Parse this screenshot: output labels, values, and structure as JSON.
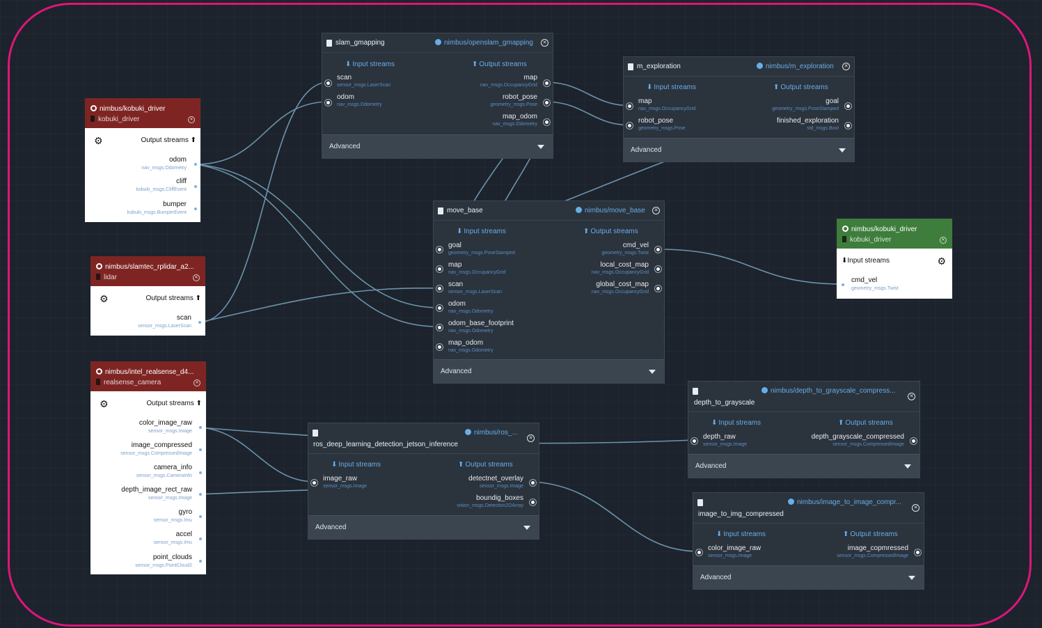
{
  "colors": {
    "canvas": "#1c232c",
    "frame": "#e0157a",
    "node_bg": "#2b333d",
    "accent_blue": "#68aee8",
    "type_blue": "#5b8fc4",
    "hw_red": "#7e2523",
    "hw_green": "#3e7d3c",
    "wire": "#6d93ad"
  },
  "labels": {
    "input_streams": "Input streams",
    "output_streams": "Output streams",
    "advanced": "Advanced"
  },
  "hardware": {
    "kobuki_out": {
      "image": "nimbus/kobuki_driver",
      "name": "kobuki_driver",
      "ports": [
        {
          "name": "odom",
          "type": "nav_msgs.Odometry"
        },
        {
          "name": "cliff",
          "type": "kobuki_msgs.CliffEvent"
        },
        {
          "name": "bumper",
          "type": "kobuki_msgs.BumperEvent"
        }
      ]
    },
    "lidar": {
      "image": "nimbus/slamtec_rplidar_a2...",
      "name": "lidar",
      "ports": [
        {
          "name": "scan",
          "type": "sensor_msgs.LaserScan"
        }
      ]
    },
    "camera": {
      "image": "nimbus/intel_realsense_d4...",
      "name": "realsense_camera",
      "ports": [
        {
          "name": "color_image_raw",
          "type": "sensor_msgs.Image"
        },
        {
          "name": "image_compressed",
          "type": "sensor_msgs.CompressedImage"
        },
        {
          "name": "camera_info",
          "type": "sensor_msgs.CameraInfo"
        },
        {
          "name": "depth_image_rect_raw",
          "type": "sensor_msgs.Image"
        },
        {
          "name": "gyro",
          "type": "sensor_msgs.Imu"
        },
        {
          "name": "accel",
          "type": "sensor_msgs.Imu"
        },
        {
          "name": "point_clouds",
          "type": "sensor_msgs.PointCloud2"
        }
      ]
    },
    "kobuki_in": {
      "image": "nimbus/kobuki_driver",
      "name": "kobuki_driver",
      "ports": [
        {
          "name": "cmd_vel",
          "type": "geometry_msgs.Twist"
        }
      ]
    }
  },
  "nodes": {
    "slam": {
      "title": "slam_gmapping",
      "image": "nimbus/openslam_gmapping",
      "inputs": [
        {
          "name": "scan",
          "type": "sensor_msgs.LaserScan"
        },
        {
          "name": "odom",
          "type": "nav_msgs.Odometry"
        }
      ],
      "outputs": [
        {
          "name": "map",
          "type": "nav_msgs.OccupancyGrid"
        },
        {
          "name": "robot_pose",
          "type": "geometry_msgs.Pose"
        },
        {
          "name": "map_odom",
          "type": "nav_msgs.Odometry"
        }
      ]
    },
    "explore": {
      "title": "m_exploration",
      "image": "nimbus/m_exploration",
      "inputs": [
        {
          "name": "map",
          "type": "nav_msgs.OccupancyGrid"
        },
        {
          "name": "robot_pose",
          "type": "geometry_msgs.Pose"
        }
      ],
      "outputs": [
        {
          "name": "goal",
          "type": "geometry_msgs.PoseStamped"
        },
        {
          "name": "finished_exploration",
          "type": "std_msgs.Bool"
        }
      ]
    },
    "move": {
      "title": "move_base",
      "image": "nimbus/move_base",
      "inputs": [
        {
          "name": "goal",
          "type": "geometry_msgs.PoseStamped"
        },
        {
          "name": "map",
          "type": "nav_msgs.OccupancyGrid"
        },
        {
          "name": "scan",
          "type": "sensor_msgs.LaserScan"
        },
        {
          "name": "odom",
          "type": "nav_msgs.Odometry"
        },
        {
          "name": "odom_base_footprint",
          "type": "nav_msgs.Odometry"
        },
        {
          "name": "map_odom",
          "type": "nav_msgs.Odometry"
        }
      ],
      "outputs": [
        {
          "name": "cmd_vel",
          "type": "geometry_msgs.Twist"
        },
        {
          "name": "local_cost_map",
          "type": "nav_msgs.OccupancyGrid"
        },
        {
          "name": "global_cost_map",
          "type": "nav_msgs.OccupancyGrid"
        }
      ]
    },
    "depth": {
      "title": "depth_to_grayscale",
      "image": "nimbus/depth_to_grayscale_compress...",
      "inputs": [
        {
          "name": "depth_raw",
          "type": "sensor_msgs.Image"
        }
      ],
      "outputs": [
        {
          "name": "depth_grayscale_compressed",
          "type": "sensor_msgs.CompressedImage"
        }
      ]
    },
    "ros": {
      "title": "ros_deep_learning_detection_jetson_inference",
      "image": "nimbus/ros_...",
      "inputs": [
        {
          "name": "image_raw",
          "type": "sensor_msgs.Image"
        }
      ],
      "outputs": [
        {
          "name": "detectnet_overlay",
          "type": "sensor_msgs.Image"
        },
        {
          "name": "boundig_boxes",
          "type": "vision_msgs.Detection2DArray"
        }
      ]
    },
    "i2i": {
      "title": "image_to_img_compressed",
      "image": "nimbus/image_to_image_compr...",
      "inputs": [
        {
          "name": "color_image_raw",
          "type": "sensor_msgs.Image"
        }
      ],
      "outputs": [
        {
          "name": "image_copmressed",
          "type": "sensor_msgs.CompressedImage"
        }
      ]
    }
  }
}
